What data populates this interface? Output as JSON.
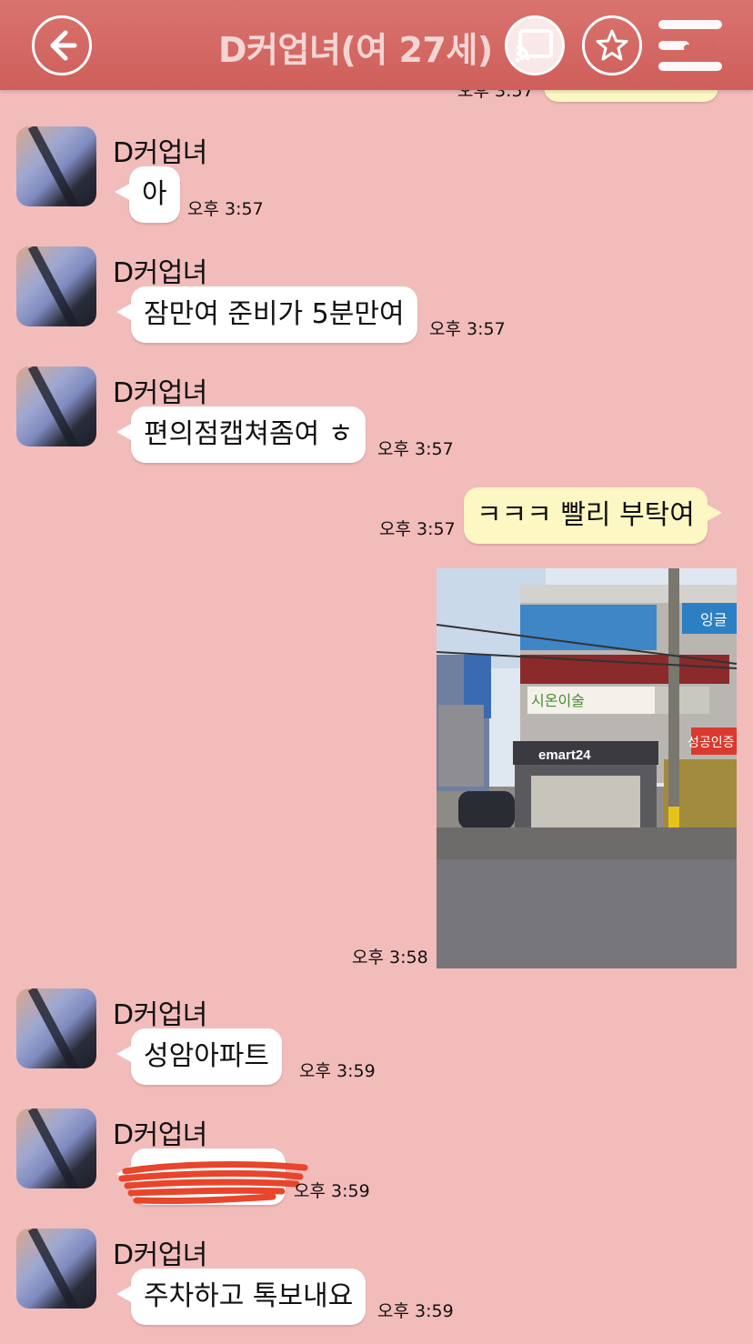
{
  "header": {
    "title": "D커업녀(여 27세)",
    "back_icon": "back-arrow-icon",
    "cast_icon": "cast-icon",
    "star_icon": "star-icon",
    "menu_icon": "menu-icon"
  },
  "top_partial": {
    "time": "오후 3:57"
  },
  "messages": [
    {
      "sender": "D커업녀",
      "text": "아",
      "time": "오후 3:57"
    },
    {
      "sender": "D커업녀",
      "text": "잠만여 준비가 5분만여",
      "time": "오후 3:57"
    },
    {
      "sender": "D커업녀",
      "text": "편의점캡쳐좀여 ㅎ",
      "time": "오후 3:57"
    },
    {
      "sender": "me",
      "text": "ㅋㅋㅋ 빨리 부탁여",
      "time": "오후 3:57"
    },
    {
      "sender": "me",
      "type": "photo",
      "time": "오후 3:58",
      "photo_signs": {
        "store": "emart24",
        "sign2": "시온이술",
        "sign3": "성공인증",
        "sign4": "잉글"
      }
    },
    {
      "sender": "D커업녀",
      "text": "성암아파트",
      "time": "오후 3:59"
    },
    {
      "sender": "D커업녀",
      "text": "",
      "redacted": true,
      "time": "오후 3:59"
    },
    {
      "sender": "D커업녀",
      "text": "주차하고 톡보내요",
      "time": "오후 3:59"
    }
  ],
  "colors": {
    "header": "#cf5f5b",
    "background": "#f2bcba",
    "incoming_bubble": "#ffffff",
    "outgoing_bubble": "#fdf7c3",
    "redaction": "#e8452c"
  }
}
